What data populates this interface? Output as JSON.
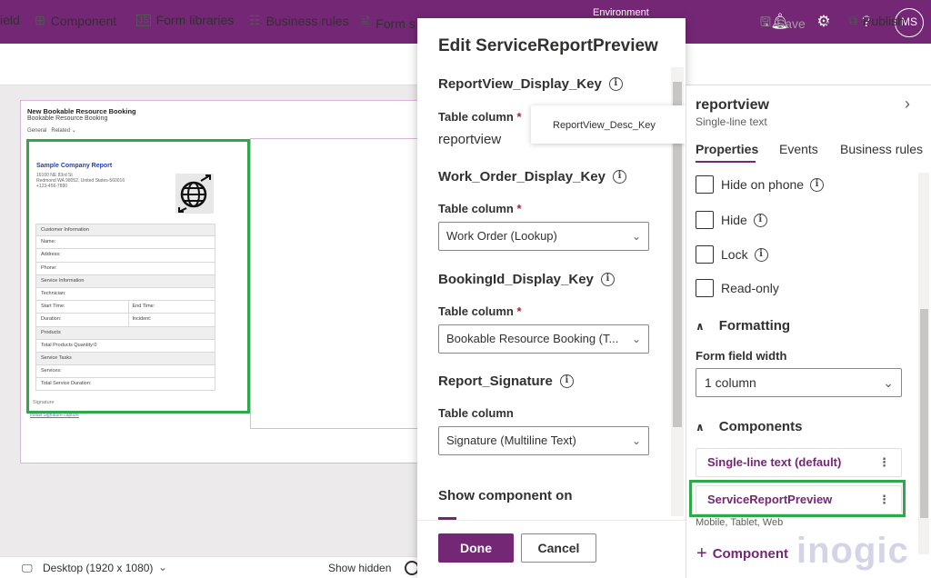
{
  "topbar": {
    "environment_label": "Environment",
    "avatar_initials": "MS"
  },
  "cmdbar": {
    "field": "ield",
    "component": "Component",
    "form_libraries": "Form libraries",
    "business_rules": "Business rules",
    "form_settings": "Form s",
    "save": "Save",
    "publish": "Publish"
  },
  "preview_form": {
    "title": "New Bookable Resource Booking",
    "subtitle": "Bookable Resource Booking",
    "tab_general": "General",
    "tab_related": "Related",
    "report_title": "Sample Company Report",
    "address_line1": "16100 NE 83rd St",
    "address_line2": "Redmond WA 98052, United States-560016",
    "address_line3": "+123-456-7890",
    "rows": {
      "customer_info": "Customer Information",
      "name": "Name:",
      "address": "Address:",
      "phone": "Phone:",
      "service_info": "Service Information",
      "technician": "Technician:",
      "start_time": "Start Time:",
      "end_time": "End Time:",
      "duration": "Duration:",
      "incident": "Incident:",
      "products": "Products",
      "total_products": "Total Products Quantity:0",
      "service_tasks": "Service Tasks",
      "services": "Services:",
      "total_service_duration": "Total Service Duration:"
    },
    "signature": "Signature",
    "signature_link": "Install Signature capture"
  },
  "statusbar": {
    "desktop": "Desktop (1920 x 1080)",
    "show_hidden": "Show hidden"
  },
  "dialog": {
    "title": "Edit ServiceReportPreview",
    "sections": [
      {
        "label": "ReportView_Display_Key",
        "sub": "Table column",
        "required": true,
        "value": "reportview"
      },
      {
        "label": "Work_Order_Display_Key",
        "sub": "Table column",
        "required": true,
        "value": "Work Order (Lookup)"
      },
      {
        "label": "BookingId_Display_Key",
        "sub": "Table column",
        "required": true,
        "value": "Bookable Resource Booking (T..."
      },
      {
        "label": "Report_Signature",
        "sub": "Table column",
        "required": false,
        "value": "Signature (Multiline Text)"
      }
    ],
    "required_mark": "*",
    "show_component_on": "Show component on",
    "tooltip": "ReportView_Desc_Key",
    "done": "Done",
    "cancel": "Cancel"
  },
  "right_panel": {
    "title": "reportview",
    "subtitle": "Single-line text",
    "tabs": {
      "properties": "Properties",
      "events": "Events",
      "business_rules": "Business rules"
    },
    "hide_on_phone": "Hide on phone",
    "hide": "Hide",
    "lock": "Lock",
    "read_only": "Read-only",
    "formatting": "Formatting",
    "form_field_width": "Form field width",
    "field_width_value": "1 column",
    "components": "Components",
    "component_items": [
      "Single-line text (default)",
      "ServiceReportPreview"
    ],
    "component_devices": "Mobile, Tablet, Web",
    "add_component": "Component"
  },
  "watermark": "inogic",
  "colors": {
    "brand": "#742774",
    "highlight": "#2ea84a"
  }
}
